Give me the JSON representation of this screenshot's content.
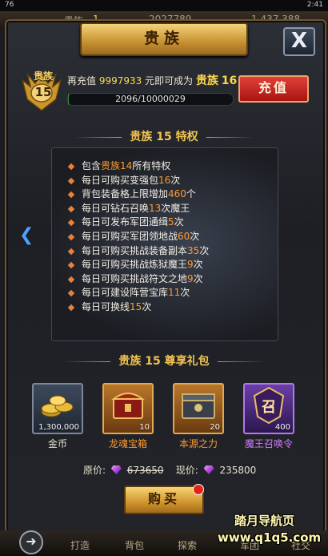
{
  "status_bar": {
    "left": "76",
    "time": "2:41"
  },
  "top_bar": {
    "label": "贵族",
    "level": "1",
    "gems": "2027789",
    "gold": "1,437,388"
  },
  "dialog": {
    "title": "贵族",
    "close": "X"
  },
  "vip": {
    "label": "贵族",
    "level": "15",
    "recharge_prefix": "再充值",
    "recharge_amount": "9997933",
    "recharge_mid": "元即可成为",
    "next_label": "贵族",
    "next_level": "16",
    "progress_text": "2096/10000029",
    "progress_fraction": 0.0002,
    "recharge_button": "充值"
  },
  "privileges": {
    "title": "贵族 15 特权",
    "items": [
      {
        "pre": "包含",
        "hl": "贵族14",
        "post": "所有特权"
      },
      {
        "pre": "每日可购买变强包",
        "hl": "16",
        "post": "次"
      },
      {
        "pre": "背包装备格上限增加",
        "hl": "460",
        "post": "个"
      },
      {
        "pre": "每日可钻石召唤",
        "hl": "13",
        "post": "次魔王"
      },
      {
        "pre": "每日可发布军团通缉",
        "hl": "5",
        "post": "次"
      },
      {
        "pre": "每日可购买军团领地战",
        "hl": "60",
        "post": "次"
      },
      {
        "pre": "每日可购买挑战装备副本",
        "hl": "35",
        "post": "次"
      },
      {
        "pre": "每日可购买挑战炼狱魔王",
        "hl": "9",
        "post": "次"
      },
      {
        "pre": "每日可购买挑战符文之地",
        "hl": "9",
        "post": "次"
      },
      {
        "pre": "每日可建设阵营宝库",
        "hl": "11",
        "post": "次"
      },
      {
        "pre": "每日可换线",
        "hl": "15",
        "post": "次"
      }
    ]
  },
  "gift": {
    "title": "贵族 15 尊享礼包",
    "items": [
      {
        "name": "金币",
        "count": "1,300,000",
        "color": "#e8e0cf"
      },
      {
        "name": "龙魂宝箱",
        "count": "10",
        "color": "#ff9a30"
      },
      {
        "name": "本源之力",
        "count": "20",
        "color": "#ff9a30"
      },
      {
        "name": "魔王召唤令",
        "count": "400",
        "color": "#d27bff",
        "glyph": "召"
      }
    ],
    "original_label": "原价:",
    "original_price": "673650",
    "current_label": "现价:",
    "current_price": "235800",
    "buy_button": "购买"
  },
  "bottom_nav": [
    "打造",
    "背包",
    "探索",
    "军团",
    "社交"
  ],
  "watermark": {
    "line1": "踏月导航页",
    "line2": "www.q1q5.com"
  }
}
